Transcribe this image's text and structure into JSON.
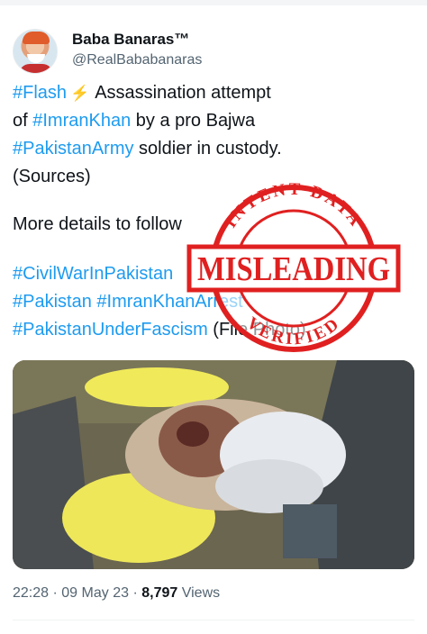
{
  "author": {
    "display_name": "Baba Banaras™",
    "handle": "@RealBababanaras"
  },
  "tweet": {
    "line1": {
      "hashtag": "#Flash",
      "icon": "lightning-icon",
      "text": "Assassination attempt"
    },
    "line2": {
      "prefix": "of ",
      "hashtag": "#ImranKhan",
      "text": " by a pro Bajwa"
    },
    "line3": {
      "hashtag": "#PakistanArmy",
      "text": " soldier in custody."
    },
    "line4": {
      "text": "(Sources)"
    },
    "line5": {
      "text": "More details to follow"
    },
    "line6": {
      "hashtag": "#CivilWarInPakistan"
    },
    "line7": {
      "hashtag1": "#Pakistan",
      "hashtag2": "#ImranKhanArrest"
    },
    "line8": {
      "hashtag": "#PakistanUnderFascism",
      "text": " (File Photo)"
    }
  },
  "stamp": {
    "top_text": "INTENT DATA",
    "main_text": "MISLEADING",
    "bottom_text": "VERIFIED",
    "color": "#e02020"
  },
  "meta": {
    "time": "22:28",
    "separator": "·",
    "date": "09 May 23",
    "views_count": "8,797",
    "views_label": "Views"
  },
  "colors": {
    "link": "#1d9bf0",
    "text": "#0f1419",
    "secondary": "#536471"
  }
}
